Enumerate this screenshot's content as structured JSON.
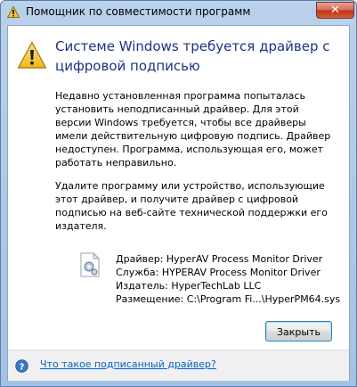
{
  "window": {
    "title": "Помощник по совместимости программ",
    "close_glyph": "✕"
  },
  "message": {
    "heading": "Системе Windows требуется драйвер с цифровой подписью",
    "paragraph1": "Недавно установленная программа попыталась установить неподписанный драйвер. Для этой версии Windows требуется, чтобы все драйверы имели действительную цифровую подпись. Драйвер недоступен. Программа, использующая его, может работать неправильно.",
    "paragraph2": "Удалите программу или устройство, использующие этот драйвер, и получите драйвер с цифровой подписью на веб-сайте технической поддержки его издателя."
  },
  "driver": {
    "driver_line": "Драйвер: HyperAV Process Monitor Driver",
    "service_line": "Служба: HYPERAV Process Monitor Driver",
    "publisher_line": "Издатель: HyperTechLab LLC",
    "location_line": "Размещение: C:\\Program Fi...\\HyperPM64.sys"
  },
  "buttons": {
    "close_label": "Закрыть"
  },
  "footer": {
    "help_link": "Что такое подписанный драйвер?"
  },
  "icons": {
    "title_icon": "warning-icon",
    "main_icon": "warning-icon",
    "driver_icon": "driver-file-icon",
    "help_icon": "help-icon"
  },
  "colors": {
    "heading": "#1e3287",
    "link": "#0066cc",
    "warning_yellow": "#f6c83a",
    "close_button_red": "#c0331c"
  }
}
